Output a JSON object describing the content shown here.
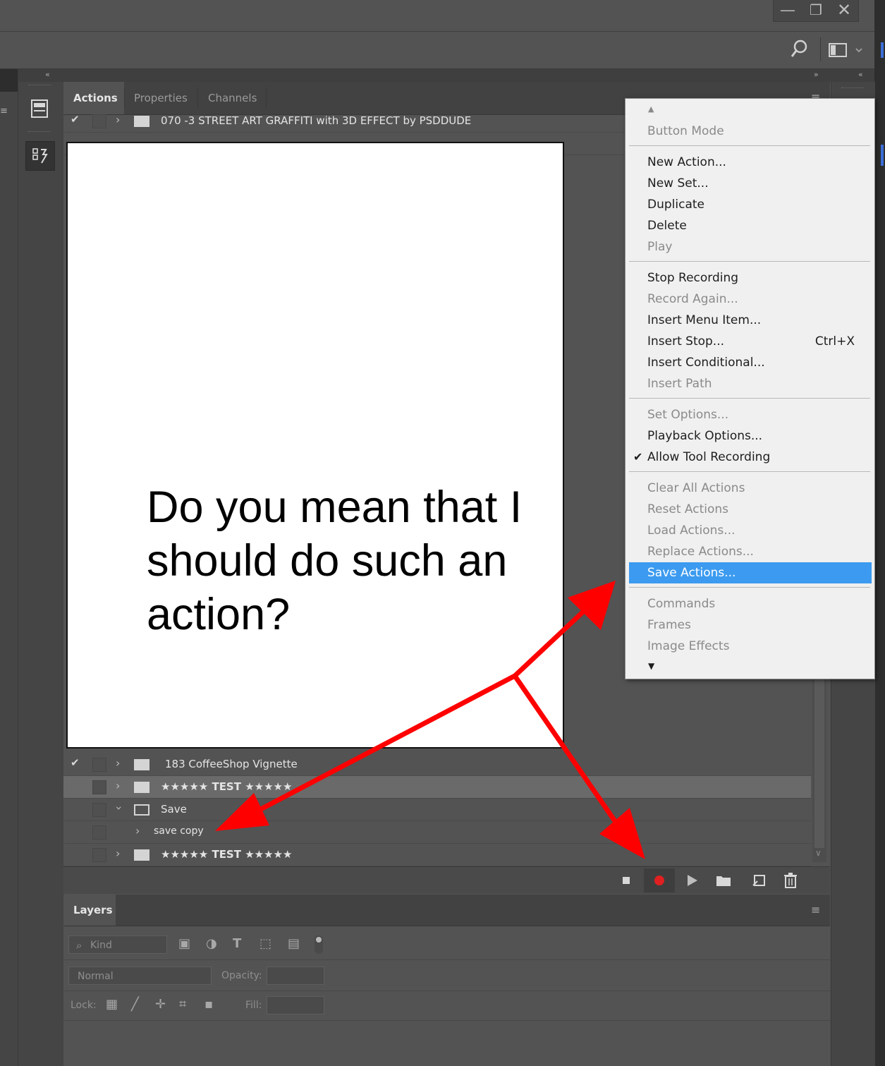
{
  "window_controls": {
    "minimize_icon": "minimize-icon",
    "restore_icon": "restore-icon",
    "close_icon": "close-icon"
  },
  "options_bar": {
    "search_icon": "search-icon",
    "workspace_icon": "workspace-icon"
  },
  "actions_panel": {
    "tabs": [
      {
        "label": "Actions",
        "active": true
      },
      {
        "label": "Properties",
        "active": false
      },
      {
        "label": "Channels",
        "active": false
      }
    ],
    "top_rows": [
      {
        "label": "070 -3 STREET ART GRAFFITI with 3D EFFECT by PSDDUDE",
        "checked": true
      }
    ],
    "bottom_rows": [
      {
        "label": "183 CoffeeShop Vignette",
        "checked": true,
        "type": "set"
      },
      {
        "label": "★★★★★ TEST ★★★★★",
        "checked": false,
        "type": "set",
        "selected": true
      },
      {
        "label": "Save",
        "checked": false,
        "type": "set-open"
      },
      {
        "label": "save copy",
        "checked": false,
        "type": "action"
      },
      {
        "label": "★★★★★ TEST ★★★★★",
        "checked": false,
        "type": "set"
      }
    ],
    "toolbar": [
      "stop",
      "record",
      "play",
      "new-set",
      "new-action",
      "delete"
    ]
  },
  "layers_panel": {
    "tab_label": "Layers",
    "filter_placeholder": "Kind",
    "blend_mode": "Normal",
    "opacity_label": "Opacity:",
    "lock_label": "Lock:",
    "fill_label": "Fill:"
  },
  "context_menu": {
    "items": [
      {
        "label": "Button Mode",
        "disabled": true
      },
      {
        "label": "New Action...",
        "disabled": false
      },
      {
        "label": "New Set...",
        "disabled": false
      },
      {
        "label": "Duplicate",
        "disabled": false
      },
      {
        "label": "Delete",
        "disabled": false
      },
      {
        "label": "Play",
        "disabled": true
      },
      {
        "label": "Stop Recording",
        "disabled": false
      },
      {
        "label": "Record Again...",
        "disabled": true
      },
      {
        "label": "Insert Menu Item...",
        "disabled": false
      },
      {
        "label": "Insert Stop...",
        "disabled": false,
        "shortcut": "Ctrl+X"
      },
      {
        "label": "Insert Conditional...",
        "disabled": false
      },
      {
        "label": "Insert Path",
        "disabled": true
      },
      {
        "label": "Set Options...",
        "disabled": true
      },
      {
        "label": "Playback Options...",
        "disabled": false
      },
      {
        "label": "Allow Tool Recording",
        "disabled": false,
        "checked": true
      },
      {
        "label": "Clear All Actions",
        "disabled": true
      },
      {
        "label": "Reset Actions",
        "disabled": true
      },
      {
        "label": "Load Actions...",
        "disabled": true
      },
      {
        "label": "Replace Actions...",
        "disabled": true
      },
      {
        "label": "Save Actions...",
        "disabled": false,
        "highlighted": true
      },
      {
        "label": "Commands",
        "disabled": true
      },
      {
        "label": "Frames",
        "disabled": true
      },
      {
        "label": "Image Effects",
        "disabled": true
      }
    ]
  },
  "annotation": {
    "text": "Do you mean that I should do such an action?",
    "arrow_color": "#ff0000"
  },
  "colors": {
    "panel_bg": "#535353",
    "menu_bg": "#f0f0f0",
    "highlight": "#3c9bf0",
    "record": "#e02020"
  }
}
